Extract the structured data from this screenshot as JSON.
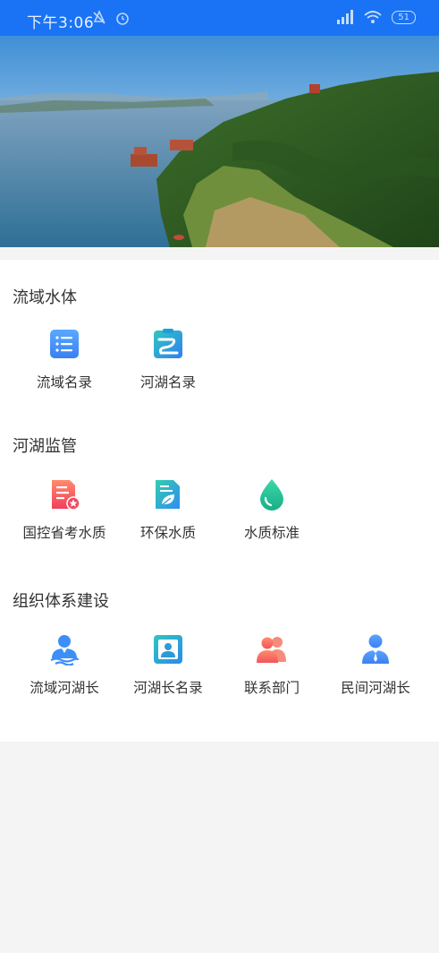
{
  "status_bar": {
    "time": "下午3:06",
    "battery": "51"
  },
  "sections": [
    {
      "title": "流域水体",
      "items": [
        {
          "label": "流域名录",
          "icon": "list-icon"
        },
        {
          "label": "河湖名录",
          "icon": "river-clipboard-icon"
        }
      ]
    },
    {
      "title": "河湖监管",
      "items": [
        {
          "label": "国控省考水质",
          "icon": "document-star-icon"
        },
        {
          "label": "环保水质",
          "icon": "document-leaf-icon"
        },
        {
          "label": "水质标准",
          "icon": "water-drop-icon"
        }
      ]
    },
    {
      "title": "组织体系建设",
      "items": [
        {
          "label": "流域河湖长",
          "icon": "person-water-icon"
        },
        {
          "label": "河湖长名录",
          "icon": "contact-card-icon"
        },
        {
          "label": "联系部门",
          "icon": "people-icon"
        },
        {
          "label": "民间河湖长",
          "icon": "person-tie-icon"
        }
      ]
    }
  ],
  "colors": {
    "status_bar": "#1a73f5",
    "accent_blue": "#3d8ef7",
    "accent_red": "#f2555a",
    "accent_green": "#24c296"
  }
}
